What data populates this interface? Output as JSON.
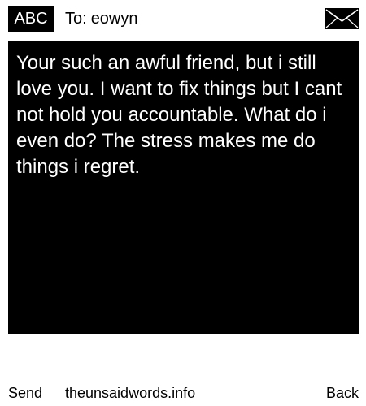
{
  "header": {
    "mode_badge": "ABC",
    "to_label": "To:",
    "recipient": "eowyn",
    "envelope_icon": "envelope-icon"
  },
  "message": {
    "body": "Your such an awful friend, but i still love you. I want to fix things but I cant not hold you accountable. What do i even do? The stress makes me do things i regret."
  },
  "footer": {
    "send_label": "Send",
    "site_label": "theunsaidwords.info",
    "back_label": "Back"
  },
  "colors": {
    "background": "#ffffff",
    "panel": "#000000",
    "text_on_panel": "#ffffff"
  }
}
